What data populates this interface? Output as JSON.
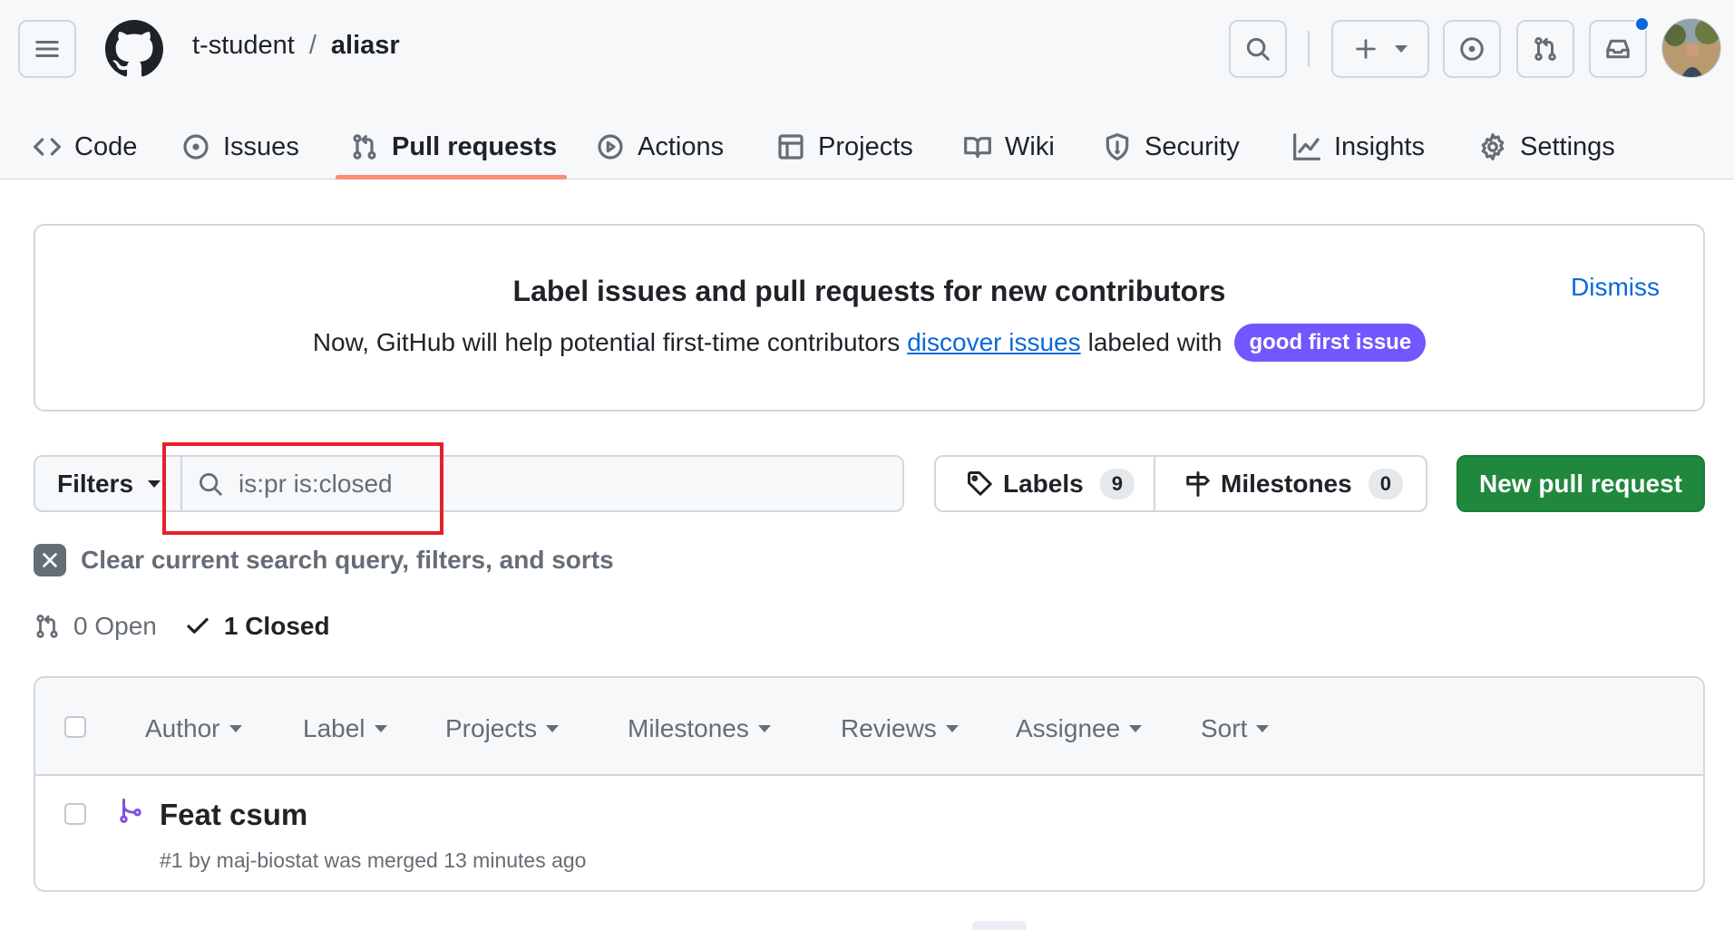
{
  "header": {
    "owner": "t-student",
    "separator": "/",
    "repo": "aliasr",
    "icons": [
      "hamburger-icon",
      "github-logo",
      "search-icon",
      "plus-icon",
      "issue-icon",
      "pull-request-icon",
      "inbox-icon"
    ],
    "notification_dot_color": "#0969da"
  },
  "tabs": [
    {
      "label": "Code",
      "icon": "code-icon"
    },
    {
      "label": "Issues",
      "icon": "issue-opened-icon"
    },
    {
      "label": "Pull requests",
      "icon": "git-pull-request-icon",
      "active": true
    },
    {
      "label": "Actions",
      "icon": "play-icon"
    },
    {
      "label": "Projects",
      "icon": "table-icon"
    },
    {
      "label": "Wiki",
      "icon": "book-icon"
    },
    {
      "label": "Security",
      "icon": "shield-icon"
    },
    {
      "label": "Insights",
      "icon": "graph-icon"
    },
    {
      "label": "Settings",
      "icon": "gear-icon"
    }
  ],
  "banner": {
    "title": "Label issues and pull requests for new contributors",
    "text_before": "Now, GitHub will help potential first-time contributors",
    "link": "discover issues",
    "text_after": "labeled with",
    "label": "good first issue",
    "label_color": "#7057ff",
    "dismiss": "Dismiss"
  },
  "filterbar": {
    "filters_label": "Filters",
    "search_value": "is:pr is:closed",
    "labels_label": "Labels",
    "labels_count": "9",
    "milestones_label": "Milestones",
    "milestones_count": "0",
    "new_pr_label": "New pull request",
    "new_pr_color": "#1f883d",
    "highlight_color": "#e5202a"
  },
  "clear": {
    "label": "Clear current search query, filters, and sorts"
  },
  "states": {
    "open": "0 Open",
    "closed": "1 Closed"
  },
  "list": {
    "filters": [
      "Author",
      "Label",
      "Projects",
      "Milestones",
      "Reviews",
      "Assignee",
      "Sort"
    ],
    "items": [
      {
        "title": "Feat csum",
        "meta": "#1 by maj-biostat was merged 13 minutes ago",
        "icon": "git-merge-icon",
        "icon_color": "#8250df"
      }
    ]
  }
}
